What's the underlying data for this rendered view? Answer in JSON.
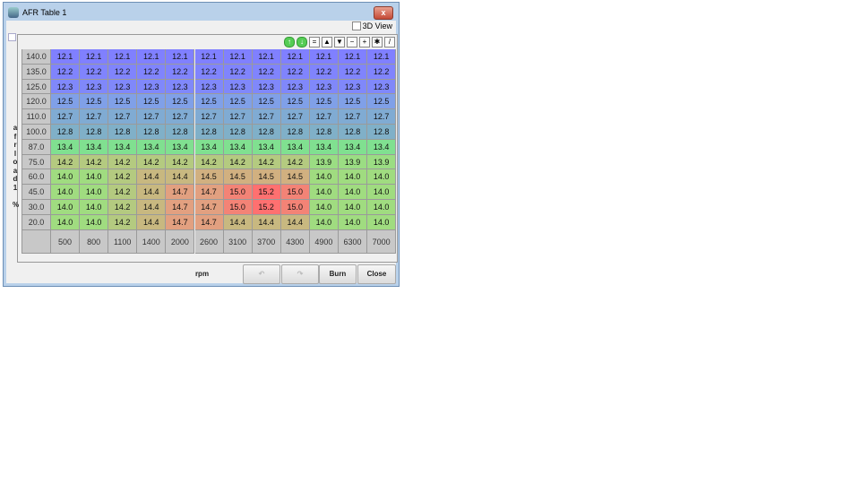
{
  "window": {
    "title": "AFR Table 1",
    "close": "x"
  },
  "view3d": {
    "label": "3D View",
    "checked": false
  },
  "toolbar": [
    "coarse-up",
    "coarse-down",
    "equal",
    "up",
    "down",
    "minus",
    "plus",
    "multiply",
    "pen"
  ],
  "toolbar_glyphs": [
    "↑",
    "↓",
    "=",
    "▲",
    "▼",
    "−",
    "+",
    "✱",
    "/"
  ],
  "y_axis": {
    "label": "afrload1 %",
    "letters": [
      "a",
      "f",
      "r",
      "l",
      "o",
      "a",
      "d",
      "1",
      "",
      "%"
    ],
    "values": [
      "140.0",
      "135.0",
      "125.0",
      "120.0",
      "110.0",
      "100.0",
      "87.0",
      "75.0",
      "60.0",
      "45.0",
      "30.0",
      "20.0"
    ]
  },
  "x_axis": {
    "label": "rpm",
    "values": [
      "500",
      "800",
      "1100",
      "1400",
      "2000",
      "2600",
      "3100",
      "3700",
      "4300",
      "4900",
      "6300",
      "7000"
    ]
  },
  "table": [
    [
      "12.1",
      "12.1",
      "12.1",
      "12.1",
      "12.1",
      "12.1",
      "12.1",
      "12.1",
      "12.1",
      "12.1",
      "12.1",
      "12.1"
    ],
    [
      "12.2",
      "12.2",
      "12.2",
      "12.2",
      "12.2",
      "12.2",
      "12.2",
      "12.2",
      "12.2",
      "12.2",
      "12.2",
      "12.2"
    ],
    [
      "12.3",
      "12.3",
      "12.3",
      "12.3",
      "12.3",
      "12.3",
      "12.3",
      "12.3",
      "12.3",
      "12.3",
      "12.3",
      "12.3"
    ],
    [
      "12.5",
      "12.5",
      "12.5",
      "12.5",
      "12.5",
      "12.5",
      "12.5",
      "12.5",
      "12.5",
      "12.5",
      "12.5",
      "12.5"
    ],
    [
      "12.7",
      "12.7",
      "12.7",
      "12.7",
      "12.7",
      "12.7",
      "12.7",
      "12.7",
      "12.7",
      "12.7",
      "12.7",
      "12.7"
    ],
    [
      "12.8",
      "12.8",
      "12.8",
      "12.8",
      "12.8",
      "12.8",
      "12.8",
      "12.8",
      "12.8",
      "12.8",
      "12.8",
      "12.8"
    ],
    [
      "13.4",
      "13.4",
      "13.4",
      "13.4",
      "13.4",
      "13.4",
      "13.4",
      "13.4",
      "13.4",
      "13.4",
      "13.4",
      "13.4"
    ],
    [
      "14.2",
      "14.2",
      "14.2",
      "14.2",
      "14.2",
      "14.2",
      "14.2",
      "14.2",
      "14.2",
      "13.9",
      "13.9",
      "13.9"
    ],
    [
      "14.0",
      "14.0",
      "14.2",
      "14.4",
      "14.4",
      "14.5",
      "14.5",
      "14.5",
      "14.5",
      "14.0",
      "14.0",
      "14.0"
    ],
    [
      "14.0",
      "14.0",
      "14.2",
      "14.4",
      "14.7",
      "14.7",
      "15.0",
      "15.2",
      "15.0",
      "14.0",
      "14.0",
      "14.0"
    ],
    [
      "14.0",
      "14.0",
      "14.2",
      "14.4",
      "14.7",
      "14.7",
      "15.0",
      "15.2",
      "15.0",
      "14.0",
      "14.0",
      "14.0"
    ],
    [
      "14.0",
      "14.0",
      "14.2",
      "14.4",
      "14.7",
      "14.7",
      "14.4",
      "14.4",
      "14.4",
      "14.0",
      "14.0",
      "14.0"
    ]
  ],
  "buttons": {
    "undo": "",
    "redo": "",
    "burn": "Burn",
    "close": "Close"
  }
}
